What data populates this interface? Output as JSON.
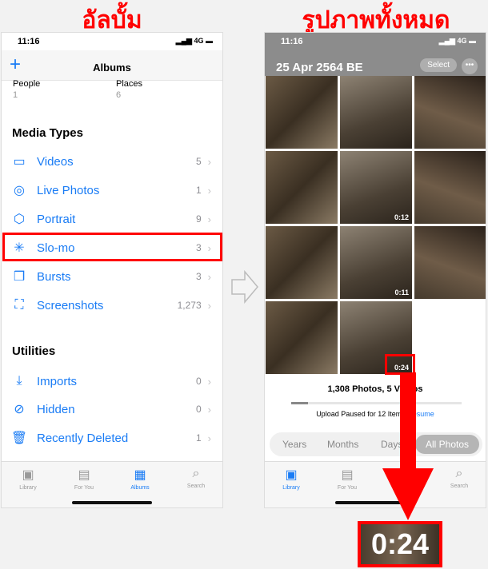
{
  "captions": {
    "left": "อัลบั้ม",
    "right": "รูปภาพทั้งหมด"
  },
  "albums_screen": {
    "status": {
      "time": "11:16",
      "network": "4G"
    },
    "header": {
      "title": "Albums",
      "add_icon": "plus-icon"
    },
    "people": {
      "label": "People",
      "count": "1"
    },
    "places": {
      "label": "Places",
      "count": "6"
    },
    "media_types": {
      "title": "Media Types",
      "items": [
        {
          "label": "Videos",
          "count": "5",
          "icon": "video-icon"
        },
        {
          "label": "Live Photos",
          "count": "1",
          "icon": "live-photo-icon"
        },
        {
          "label": "Portrait",
          "count": "9",
          "icon": "cube-icon"
        },
        {
          "label": "Slo-mo",
          "count": "3",
          "icon": "slomo-icon"
        },
        {
          "label": "Bursts",
          "count": "3",
          "icon": "bursts-icon"
        },
        {
          "label": "Screenshots",
          "count": "1,273",
          "icon": "screenshot-icon"
        }
      ]
    },
    "utilities": {
      "title": "Utilities",
      "items": [
        {
          "label": "Imports",
          "count": "0",
          "icon": "import-icon"
        },
        {
          "label": "Hidden",
          "count": "0",
          "icon": "eye-slash-icon"
        },
        {
          "label": "Recently Deleted",
          "count": "1",
          "icon": "trash-icon"
        }
      ]
    },
    "tabs": [
      {
        "label": "Library"
      },
      {
        "label": "For You"
      },
      {
        "label": "Albums",
        "active": true
      },
      {
        "label": "Search"
      }
    ]
  },
  "photos_screen": {
    "status": {
      "time": "11:16",
      "network": "4G"
    },
    "date": "25 Apr 2564 BE",
    "select_label": "Select",
    "more_label": "•••",
    "tiles": [
      "",
      "",
      "",
      "",
      "0:12",
      "",
      "",
      "0:11",
      "",
      "",
      "0:24"
    ],
    "summary": "1,308 Photos, 5 Videos",
    "upload_progress": 0.1,
    "upload_text": "Upload Paused for 12 Items",
    "resume_label": "Resume",
    "segments": [
      "Years",
      "Months",
      "Days",
      "All Photos"
    ],
    "tabs": [
      {
        "label": "Library",
        "active": true
      },
      {
        "label": "For You"
      },
      {
        "label": "Search"
      }
    ]
  },
  "zoom_label": "0:24",
  "colors": {
    "accent": "#1a7cf5",
    "highlight": "#ff0000"
  }
}
